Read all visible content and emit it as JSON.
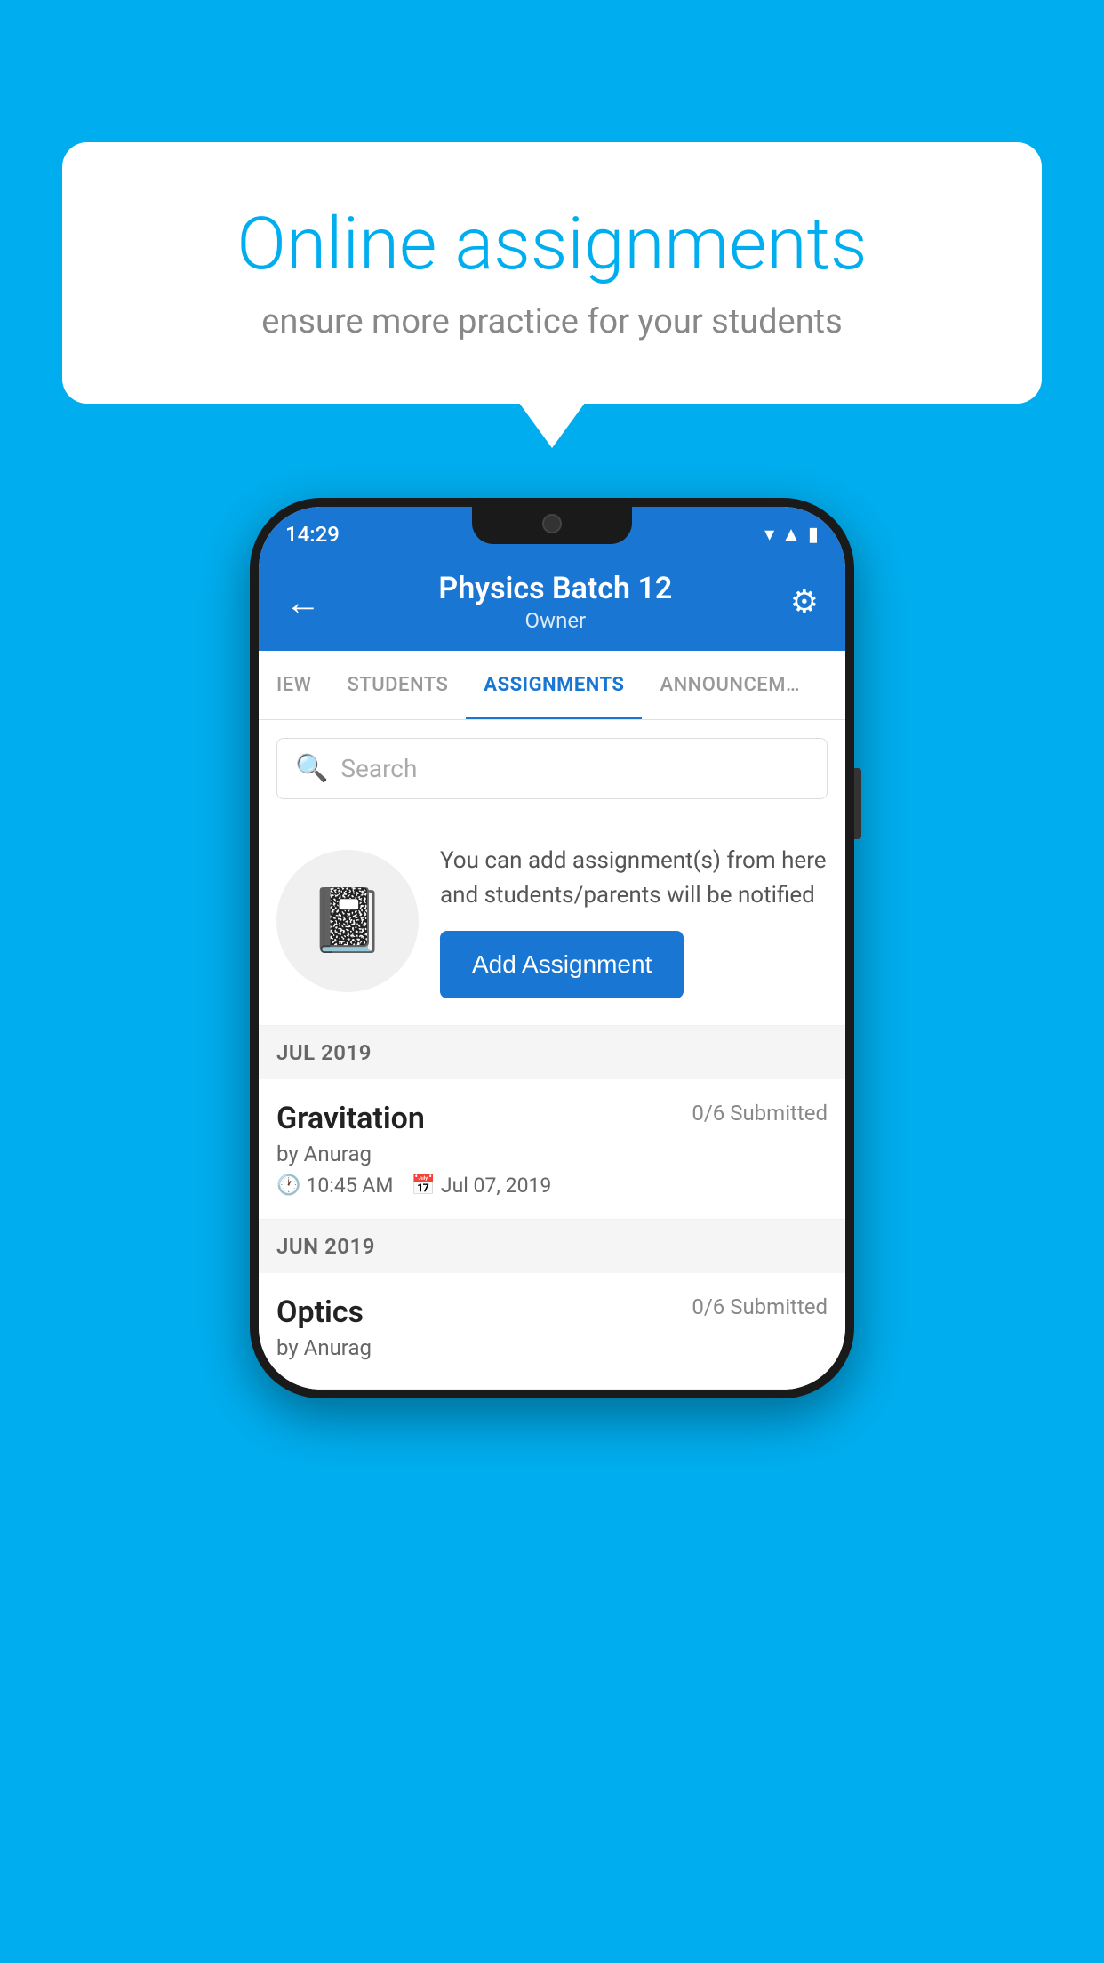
{
  "background": {
    "color": "#00AEEF"
  },
  "speech_bubble": {
    "title": "Online assignments",
    "subtitle": "ensure more practice for your students"
  },
  "status_bar": {
    "time": "14:29",
    "icons": [
      "wifi",
      "signal",
      "battery"
    ]
  },
  "header": {
    "title": "Physics Batch 12",
    "subtitle": "Owner",
    "back_label": "←",
    "settings_label": "⚙"
  },
  "tabs": [
    {
      "label": "IEW",
      "active": false
    },
    {
      "label": "STUDENTS",
      "active": false
    },
    {
      "label": "ASSIGNMENTS",
      "active": true
    },
    {
      "label": "ANNOUNCEM…",
      "active": false
    }
  ],
  "search": {
    "placeholder": "Search"
  },
  "promo": {
    "text": "You can add assignment(s) from here and students/parents will be notified",
    "button_label": "Add Assignment"
  },
  "sections": [
    {
      "label": "JUL 2019",
      "assignments": [
        {
          "name": "Gravitation",
          "submitted": "0/6 Submitted",
          "author": "by Anurag",
          "time": "10:45 AM",
          "date": "Jul 07, 2019"
        }
      ]
    },
    {
      "label": "JUN 2019",
      "assignments": [
        {
          "name": "Optics",
          "submitted": "0/6 Submitted",
          "author": "by Anurag",
          "time": "",
          "date": ""
        }
      ]
    }
  ]
}
